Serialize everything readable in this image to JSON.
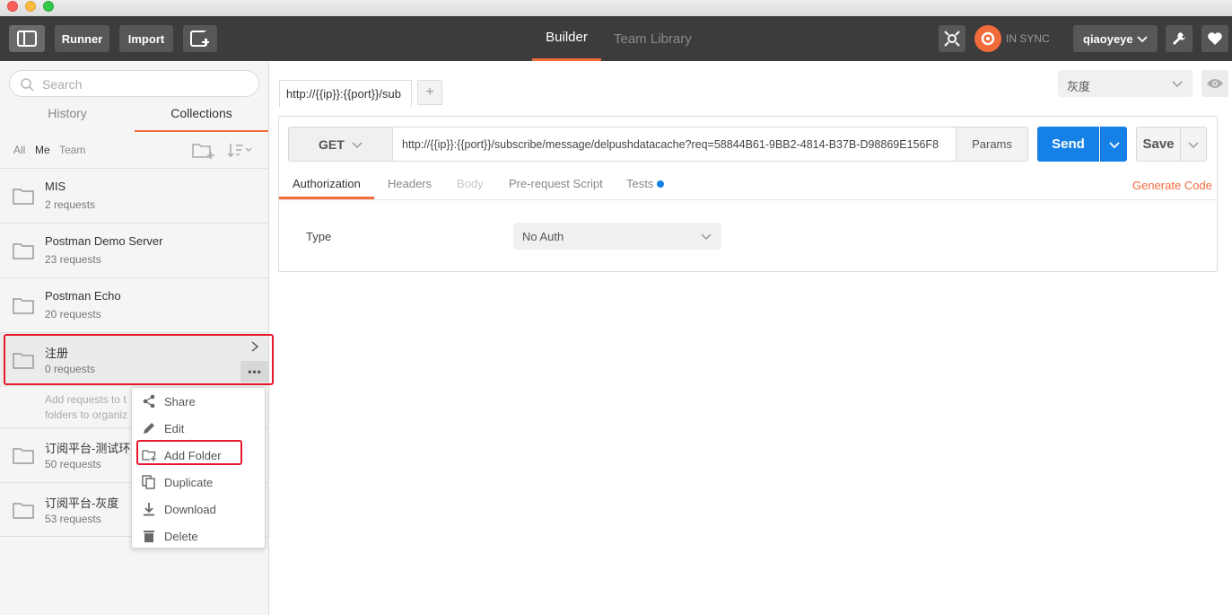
{
  "window": {
    "colors": {
      "close": "#fc605c",
      "minimize": "#fdbc40",
      "maximize": "#34c84a"
    }
  },
  "header": {
    "runner_label": "Runner",
    "import_label": "Import",
    "tabs": [
      {
        "label": "Builder",
        "active": true
      },
      {
        "label": "Team Library",
        "active": false
      }
    ],
    "sync_label": "IN SYNC",
    "user_label": "qiaoyeye",
    "icons": [
      "sidebar-toggle-icon",
      "new-window-icon",
      "interceptor-icon",
      "sync-icon",
      "chevron-down-icon",
      "wrench-icon",
      "heart-icon"
    ]
  },
  "sidebar": {
    "search_placeholder": "Search",
    "tabs": [
      {
        "label": "History",
        "active": false
      },
      {
        "label": "Collections",
        "active": true
      }
    ],
    "filters": [
      "All",
      "Me",
      "Team"
    ],
    "collections": [
      {
        "name": "MIS",
        "count": "2 requests"
      },
      {
        "name": "Postman Demo Server",
        "count": "23 requests"
      },
      {
        "name": "Postman Echo",
        "count": "20 requests"
      },
      {
        "name": "注册",
        "count": "0 requests"
      },
      {
        "name": "订阅平台-测试环",
        "count": "50 requests"
      },
      {
        "name": "订阅平台-灰度",
        "count": "53 requests"
      }
    ],
    "empty_hint_line1": "Add requests to t",
    "empty_hint_line2": "folders to organiz",
    "more_label": "•••"
  },
  "context_menu": {
    "items": [
      {
        "label": "Share",
        "icon": "share-icon"
      },
      {
        "label": "Edit",
        "icon": "edit-icon"
      },
      {
        "label": "Add Folder",
        "icon": "add-folder-icon"
      },
      {
        "label": "Duplicate",
        "icon": "duplicate-icon"
      },
      {
        "label": "Download",
        "icon": "download-icon"
      },
      {
        "label": "Delete",
        "icon": "delete-icon"
      }
    ]
  },
  "builder": {
    "request_tab_label": "http://{{ip}}:{{port}}/sub",
    "new_tab_label": "+",
    "environment": "灰度",
    "method": "GET",
    "url": "http://{{ip}}:{{port}}/subscribe/message/delpushdatacache?req=58844B61-9BB2-4814-B37B-D98869E156F8",
    "params_label": "Params",
    "send_label": "Send",
    "save_label": "Save",
    "request_tabs": [
      "Authorization",
      "Headers",
      "Body",
      "Pre-request Script",
      "Tests"
    ],
    "generate_code_label": "Generate Code",
    "auth": {
      "type_label": "Type",
      "type_value": "No Auth"
    },
    "accent_color": "#f26b3a",
    "primary_color": "#1580e6",
    "highlight_color": "#e8192c"
  }
}
